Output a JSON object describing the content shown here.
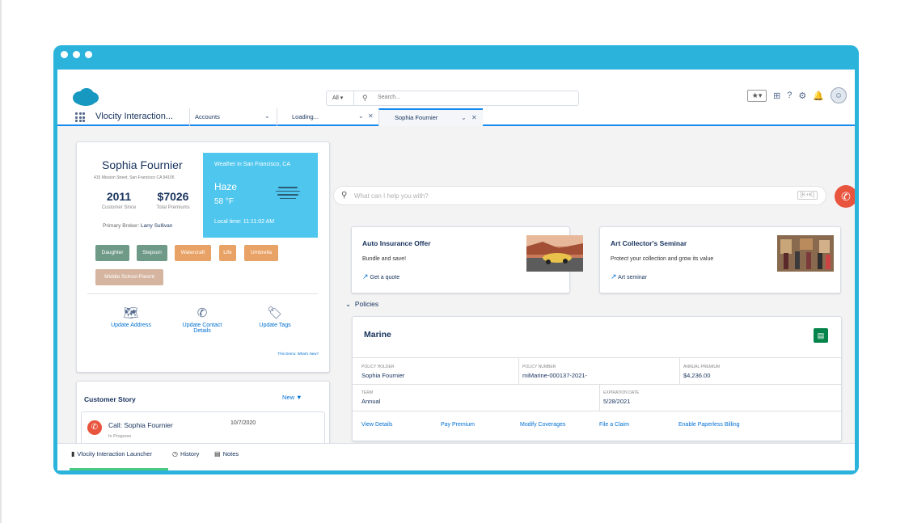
{
  "header": {
    "search_scope": "All",
    "search_placeholder": "Search...",
    "fav_label": "★▾"
  },
  "tabs": {
    "app_name": "Vlocity Interaction...",
    "items": [
      {
        "label": "Accounts"
      },
      {
        "label": "Loading..."
      },
      {
        "label": "Sophia Fournier"
      }
    ]
  },
  "profile": {
    "name": "Sophia Fournier",
    "address": "415 Mission Street, San Francisco CA 94105",
    "stats": [
      {
        "value": "2011",
        "label": "Customer Since"
      },
      {
        "value": "$7026",
        "label": "Total Premiums"
      }
    ],
    "broker_label": "Primary Broker:",
    "broker_name": "Larry Sullivan",
    "weather": {
      "title": "Weather in San Francisco, CA",
      "condition": "Haze",
      "temp": "58 °F",
      "local_time": "Local time: 11:11:02 AM"
    },
    "tags": [
      {
        "label": "Daughter",
        "color": "#6f9a87"
      },
      {
        "label": "Stepson",
        "color": "#6f9a87"
      },
      {
        "label": "Watercraft",
        "color": "#e9a265"
      },
      {
        "label": "Life",
        "color": "#e9a265"
      },
      {
        "label": "Umbrella",
        "color": "#e9a265"
      },
      {
        "label": "Middle School Parent",
        "color": "#d6b5a0"
      }
    ],
    "actions": [
      {
        "label": "Update Address",
        "icon": "map-icon"
      },
      {
        "label": "Update Contact Details",
        "icon": "phone-icon"
      },
      {
        "label": "Update Tags",
        "icon": "tag-icon"
      }
    ],
    "demo_link": "This Demo: What's New?"
  },
  "customer_story": {
    "title": "Customer Story",
    "new_label": "New ▼",
    "items": [
      {
        "title": "Call: Sophia Fournier",
        "date": "10/7/2020",
        "status": "In Progress"
      }
    ]
  },
  "quick_search": {
    "placeholder": "What can I help you with?",
    "shortcut": "[K+K]"
  },
  "offers": [
    {
      "title": "Auto Insurance Offer",
      "desc": "Bundle and save!",
      "link": "Get a quote"
    },
    {
      "title": "Art Collector's Seminar",
      "desc": "Protect your collection and grow its value",
      "link": "Art seminar"
    }
  ],
  "policies": {
    "section_label": "Policies",
    "policy": {
      "title": "Marine",
      "fields": {
        "holder": {
          "label": "Policy Holder",
          "value": "Sophia Fournier"
        },
        "number": {
          "label": "Policy Number",
          "value": "miMarine-000137-2021-"
        },
        "premium": {
          "label": "Annual Premium",
          "value": "$4,236.00"
        },
        "term": {
          "label": "Term",
          "value": "Annual"
        },
        "expiration": {
          "label": "Expiration Date",
          "value": "5/28/2021"
        }
      },
      "links": [
        "View Details",
        "Pay Premium",
        "Modify Coverages",
        "File a Claim",
        "Enable Paperless Billing"
      ]
    }
  },
  "footer": {
    "items": [
      {
        "label": "Vlocity Interaction Launcher",
        "icon": "launcher-icon"
      },
      {
        "label": "History",
        "icon": "clock-icon"
      },
      {
        "label": "Notes",
        "icon": "note-icon"
      }
    ]
  },
  "colors": {
    "frame": "#2bb3dc",
    "brand_blue": "#1589ee",
    "link": "#0070d2",
    "call_red": "#e8543d",
    "weather_bg": "#4fc6ee",
    "policy_green": "#04844b"
  }
}
